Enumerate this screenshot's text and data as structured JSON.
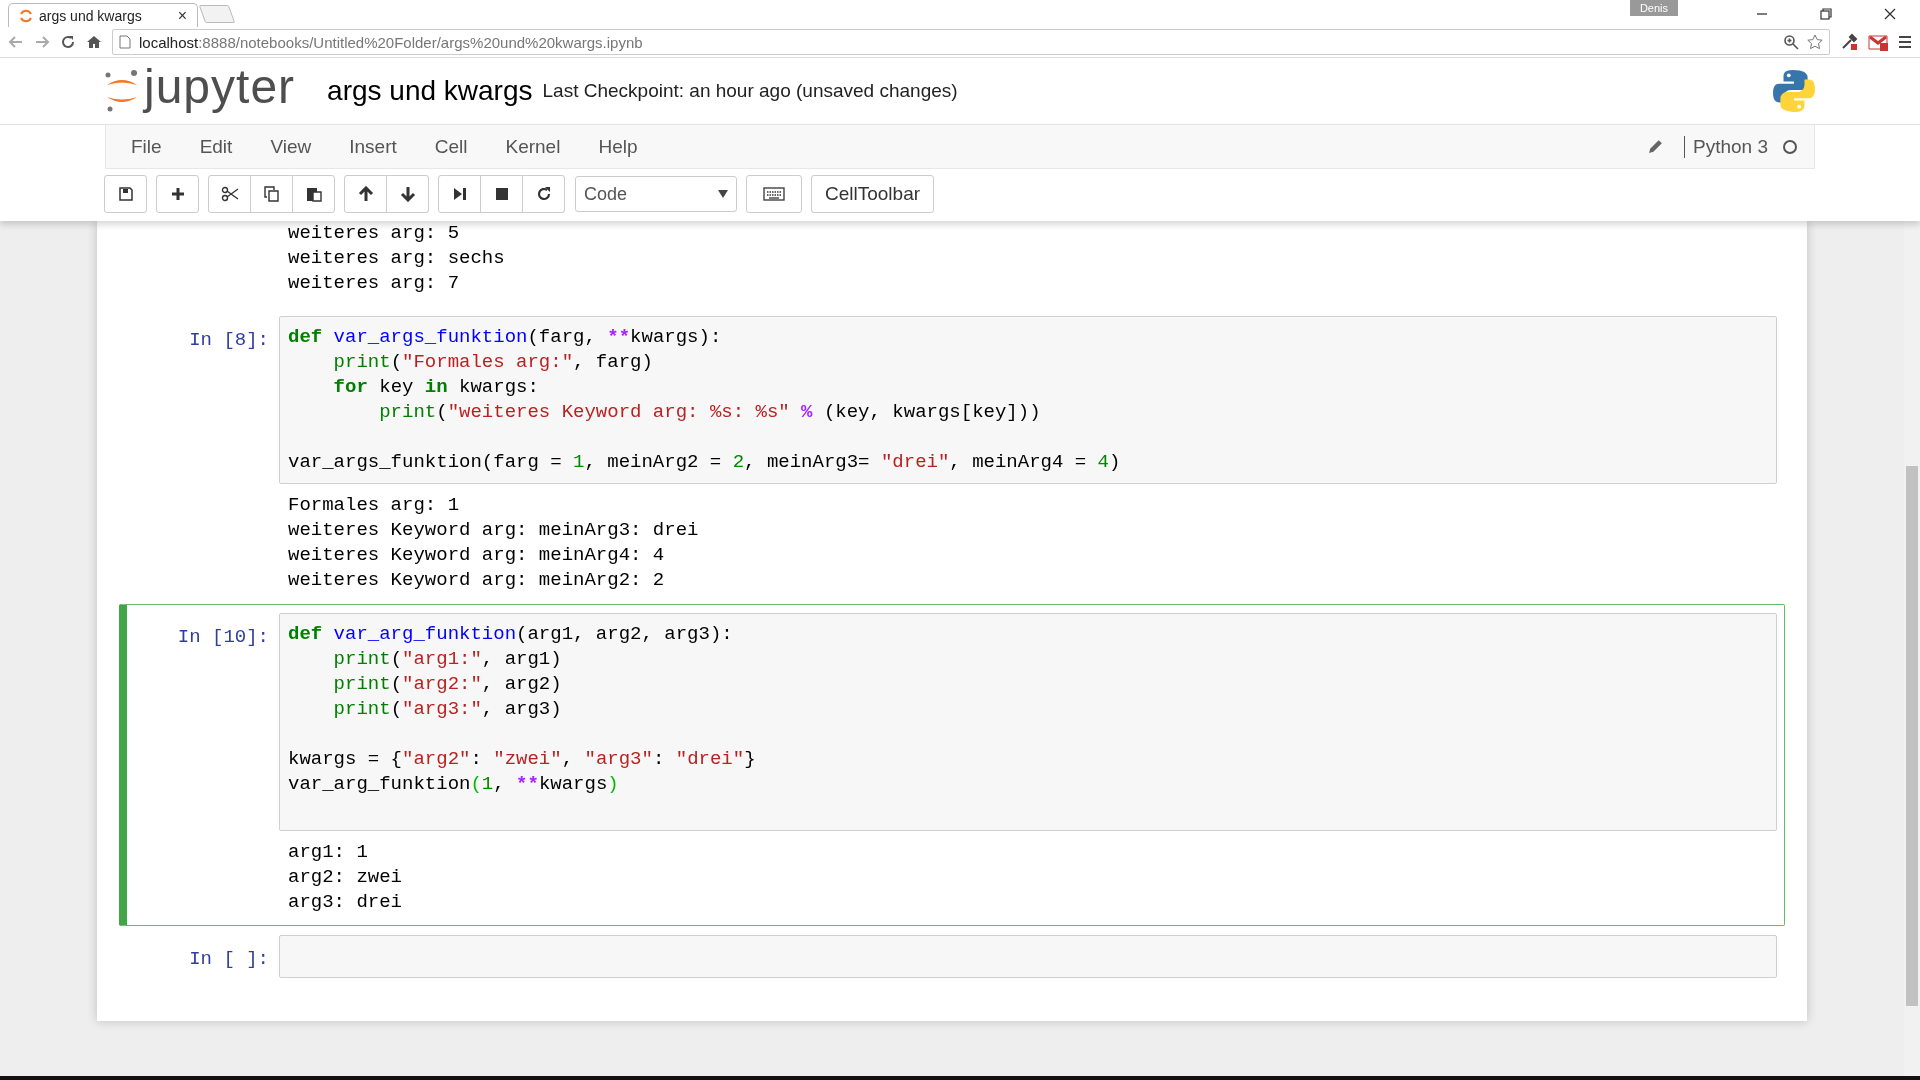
{
  "browser": {
    "tab": {
      "title": "args und kwargs",
      "close": "×"
    },
    "user": "Denis",
    "url": {
      "host": "localhost",
      "path": ":8888/notebooks/Untitled%20Folder/args%20und%20kwargs.ipynb"
    }
  },
  "header": {
    "logo": "jupyter",
    "notebook_name": "args und kwargs",
    "checkpoint": "Last Checkpoint: an hour ago (unsaved changes)"
  },
  "menubar": {
    "items": [
      "File",
      "Edit",
      "View",
      "Insert",
      "Cell",
      "Kernel",
      "Help"
    ],
    "kernel": "Python 3",
    "kernel_busy": false
  },
  "toolbar": {
    "cell_type": "Code",
    "celltoolbar": "CellToolbar"
  },
  "cells": [
    {
      "selected": false,
      "outputs": [
        "weiteres arg: 5",
        "weiteres arg: sechs",
        "weiteres arg: 7"
      ]
    },
    {
      "selected": false,
      "prompt": "In [8]:",
      "input": [
        {
          "kind": "code",
          "tokens": [
            {
              "kind": "keyword",
              "text": "def "
            },
            {
              "kind": "function",
              "text": "var_args_funktion"
            },
            {
              "kind": "plain",
              "text": "(farg, "
            },
            {
              "kind": "operator",
              "text": "**"
            },
            {
              "kind": "plain",
              "text": "kwargs):"
            }
          ]
        },
        {
          "kind": "code",
          "tokens": [
            {
              "kind": "builtin",
              "text": "    print"
            },
            {
              "kind": "plain",
              "text": "("
            },
            {
              "kind": "string",
              "text": "\"Formales arg:\""
            },
            {
              "kind": "plain",
              "text": ", farg)"
            }
          ]
        },
        {
          "kind": "code",
          "tokens": [
            {
              "kind": "keyword",
              "text": "    for"
            },
            {
              "kind": "plain",
              "text": " key "
            },
            {
              "kind": "keyword",
              "text": "in"
            },
            {
              "kind": "plain",
              "text": " kwargs:"
            }
          ]
        },
        {
          "kind": "code",
          "tokens": [
            {
              "kind": "builtin",
              "text": "        print"
            },
            {
              "kind": "plain",
              "text": "("
            },
            {
              "kind": "string",
              "text": "\"weiteres Keyword arg: %s: %s\""
            },
            {
              "kind": "operator",
              "text": " %"
            },
            {
              "kind": "plain",
              "text": " (key, kwargs[key]))"
            }
          ]
        },
        {
          "kind": "blank"
        },
        {
          "kind": "code",
          "tokens": [
            {
              "kind": "plain",
              "text": "var_args_funktion(farg = "
            },
            {
              "kind": "number",
              "text": "1"
            },
            {
              "kind": "plain",
              "text": ", meinArg2 = "
            },
            {
              "kind": "number",
              "text": "2"
            },
            {
              "kind": "plain",
              "text": ", meinArg3= "
            },
            {
              "kind": "string",
              "text": "\"drei\""
            },
            {
              "kind": "plain",
              "text": ", meinArg4 = "
            },
            {
              "kind": "number",
              "text": "4"
            },
            {
              "kind": "plain",
              "text": ")"
            }
          ]
        }
      ],
      "outputs": [
        "Formales arg: 1",
        "weiteres Keyword arg: meinArg3: drei",
        "weiteres Keyword arg: meinArg4: 4",
        "weiteres Keyword arg: meinArg2: 2"
      ]
    },
    {
      "selected": true,
      "prompt": "In [10]:",
      "input": [
        {
          "kind": "code",
          "tokens": [
            {
              "kind": "keyword",
              "text": "def "
            },
            {
              "kind": "function",
              "text": "var_arg_funktion"
            },
            {
              "kind": "plain",
              "text": "(arg1, arg2, arg3):"
            }
          ]
        },
        {
          "kind": "code",
          "tokens": [
            {
              "kind": "builtin",
              "text": "    print"
            },
            {
              "kind": "plain",
              "text": "("
            },
            {
              "kind": "string",
              "text": "\"arg1:\""
            },
            {
              "kind": "plain",
              "text": ", arg1)"
            }
          ]
        },
        {
          "kind": "code",
          "tokens": [
            {
              "kind": "builtin",
              "text": "    print"
            },
            {
              "kind": "plain",
              "text": "("
            },
            {
              "kind": "string",
              "text": "\"arg2:\""
            },
            {
              "kind": "plain",
              "text": ", arg2)"
            }
          ]
        },
        {
          "kind": "code",
          "tokens": [
            {
              "kind": "builtin",
              "text": "    print"
            },
            {
              "kind": "plain",
              "text": "("
            },
            {
              "kind": "string",
              "text": "\"arg3:\""
            },
            {
              "kind": "plain",
              "text": ", arg3)"
            }
          ]
        },
        {
          "kind": "blank"
        },
        {
          "kind": "code",
          "tokens": [
            {
              "kind": "plain",
              "text": "kwargs = {"
            },
            {
              "kind": "string",
              "text": "\"arg2\""
            },
            {
              "kind": "plain",
              "text": ": "
            },
            {
              "kind": "string",
              "text": "\"zwei\""
            },
            {
              "kind": "plain",
              "text": ", "
            },
            {
              "kind": "string",
              "text": "\"arg3\""
            },
            {
              "kind": "plain",
              "text": ": "
            },
            {
              "kind": "string",
              "text": "\"drei\""
            },
            {
              "kind": "plain",
              "text": "}"
            }
          ]
        },
        {
          "kind": "code",
          "tokens": [
            {
              "kind": "plain",
              "text": "var_arg_funktion"
            },
            {
              "kind": "bracket",
              "text": "("
            },
            {
              "kind": "number",
              "text": "1"
            },
            {
              "kind": "plain",
              "text": ", "
            },
            {
              "kind": "operator",
              "text": "**"
            },
            {
              "kind": "plain",
              "text": "kwargs"
            },
            {
              "kind": "bracket",
              "text": ")"
            }
          ]
        },
        {
          "kind": "blank"
        }
      ],
      "outputs": [
        "arg1: 1",
        "arg2: zwei",
        "arg3: drei"
      ]
    },
    {
      "selected": false,
      "prompt": "In [ ]:",
      "input": [
        {
          "kind": "blank"
        }
      ]
    }
  ]
}
